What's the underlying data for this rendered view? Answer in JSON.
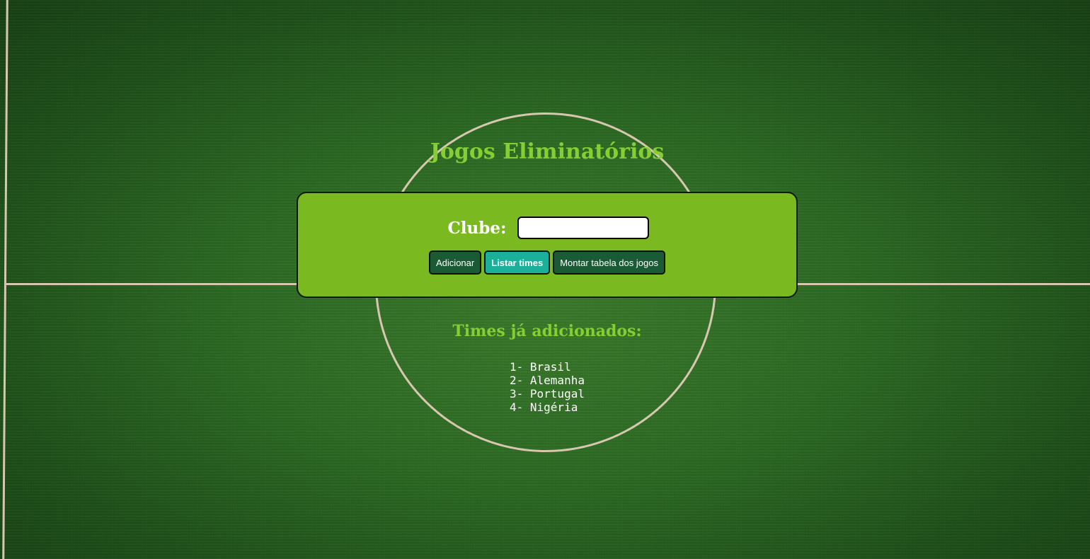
{
  "header": {
    "title": "Jogos Eliminatórios"
  },
  "form": {
    "club_label": "Clube:",
    "club_input_value": "",
    "club_input_placeholder": ""
  },
  "buttons": {
    "add_label": "Adicionar",
    "list_label": "Listar times",
    "schedule_label": "Montar tabela dos jogos"
  },
  "teams": {
    "heading": "Times já adicionados:",
    "items": [
      {
        "label": "1- Brasil"
      },
      {
        "label": "2- Alemanha"
      },
      {
        "label": "3- Portugal"
      },
      {
        "label": "4- Nigéria"
      }
    ]
  },
  "colors": {
    "title_green": "#86cf32",
    "panel_green": "#7bb920",
    "button_dark": "#1a5a34",
    "button_active": "#1bb09a",
    "field_line": "#d8c7b0"
  }
}
